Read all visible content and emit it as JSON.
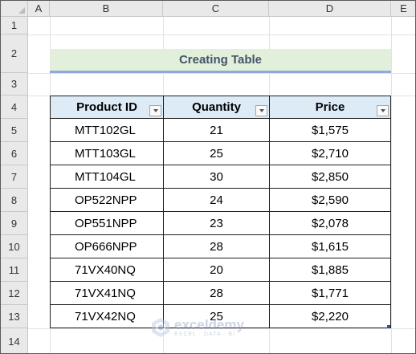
{
  "columns": [
    "A",
    "B",
    "C",
    "D",
    "E"
  ],
  "rows": [
    "1",
    "2",
    "3",
    "4",
    "5",
    "6",
    "7",
    "8",
    "9",
    "10",
    "11",
    "12",
    "13",
    "14"
  ],
  "title": "Creating Table",
  "table": {
    "headers": [
      "Product ID",
      "Quantity",
      "Price"
    ],
    "rows": [
      {
        "id": "MTT102GL",
        "qty": "21",
        "price": "$1,575"
      },
      {
        "id": "MTT103GL",
        "qty": "25",
        "price": "$2,710"
      },
      {
        "id": "MTT104GL",
        "qty": "30",
        "price": "$2,850"
      },
      {
        "id": "OP522NPP",
        "qty": "24",
        "price": "$2,590"
      },
      {
        "id": "OP551NPP",
        "qty": "23",
        "price": "$2,078"
      },
      {
        "id": "OP666NPP",
        "qty": "28",
        "price": "$1,615"
      },
      {
        "id": "71VX40NQ",
        "qty": "20",
        "price": "$1,885"
      },
      {
        "id": "71VX41NQ",
        "qty": "28",
        "price": "$1,771"
      },
      {
        "id": "71VX42NQ",
        "qty": "25",
        "price": "$2,220"
      }
    ]
  },
  "watermark": {
    "name": "exceldemy",
    "tagline": "EXCEL · DATA · BI",
    "icon": "exceldemy-logo-icon"
  },
  "colors": {
    "header_fill": "#ddebf7",
    "title_fill": "#e2efda",
    "title_text": "#44546a",
    "title_underline": "#8ea9db"
  }
}
